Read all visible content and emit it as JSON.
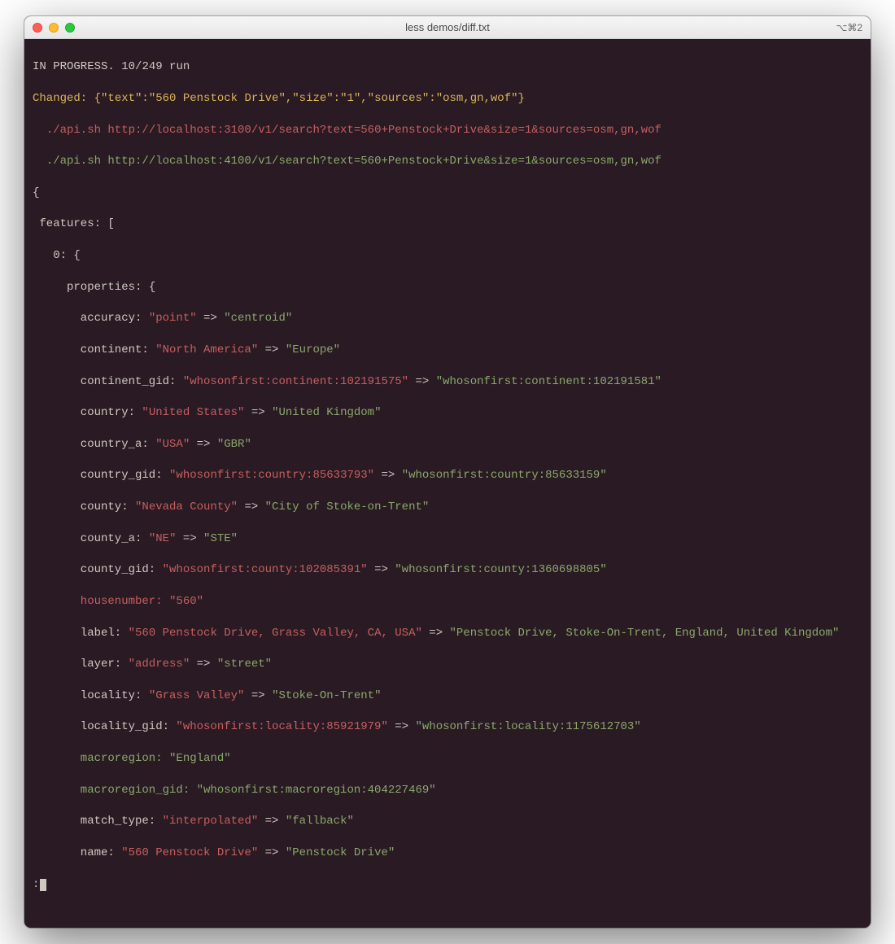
{
  "window": {
    "title": "less demos/diff.txt",
    "right_indicator": "⌥⌘2"
  },
  "progress": {
    "label": "IN PROGRESS.",
    "count": "10/249 run"
  },
  "changed_header": {
    "prefix": "Changed:",
    "json": "{\"text\":\"560 Penstock Drive\",\"size\":\"1\",\"sources\":\"osm,gn,wof\"}"
  },
  "commands": {
    "a": "./api.sh http://localhost:3100/v1/search?text=560+Penstock+Drive&size=1&sources=osm,gn,wof",
    "b": "./api.sh http://localhost:4100/v1/search?text=560+Penstock+Drive&size=1&sources=osm,gn,wof"
  },
  "struct": {
    "open_brace": "{",
    "features": "features: [",
    "idx0": "0: {",
    "properties": "properties: {"
  },
  "diff": {
    "accuracy": {
      "key": "accuracy:",
      "old": "\"point\"",
      "arrow": " => ",
      "new": "\"centroid\""
    },
    "continent": {
      "key": "continent:",
      "old": "\"North America\"",
      "arrow": " => ",
      "new": "\"Europe\""
    },
    "continent_gid": {
      "key": "continent_gid:",
      "old": "\"whosonfirst:continent:102191575\"",
      "arrow": " => ",
      "new": "\"whosonfirst:continent:102191581\""
    },
    "country": {
      "key": "country:",
      "old": "\"United States\"",
      "arrow": " => ",
      "new": "\"United Kingdom\""
    },
    "country_a": {
      "key": "country_a:",
      "old": "\"USA\"",
      "arrow": " => ",
      "new": "\"GBR\""
    },
    "country_gid": {
      "key": "country_gid:",
      "old": "\"whosonfirst:country:85633793\"",
      "arrow": " => ",
      "new": "\"whosonfirst:country:85633159\""
    },
    "county": {
      "key": "county:",
      "old": "\"Nevada County\"",
      "arrow": " => ",
      "new": "\"City of Stoke-on-Trent\""
    },
    "county_a": {
      "key": "county_a:",
      "old": "\"NE\"",
      "arrow": " => ",
      "new": "\"STE\""
    },
    "county_gid": {
      "key": "county_gid:",
      "old": "\"whosonfirst:county:102085391\"",
      "arrow": " => ",
      "new": "\"whosonfirst:county:1360698805\""
    },
    "housenumber": {
      "key": "housenumber:",
      "old": "\"560\""
    },
    "label": {
      "key": "label:",
      "old": "\"560 Penstock Drive, Grass Valley, CA, USA\"",
      "arrow": " => ",
      "new": "\"Penstock Drive, Stoke-On-Trent, England, United Kingdom\""
    },
    "layer": {
      "key": "layer:",
      "old": "\"address\"",
      "arrow": " => ",
      "new": "\"street\""
    },
    "locality": {
      "key": "locality:",
      "old": "\"Grass Valley\"",
      "arrow": " => ",
      "new": "\"Stoke-On-Trent\""
    },
    "locality_gid": {
      "key": "locality_gid:",
      "old": "\"whosonfirst:locality:85921979\"",
      "arrow": " => ",
      "new": "\"whosonfirst:locality:1175612703\""
    },
    "macroregion": {
      "key": "macroregion:",
      "new": "\"England\""
    },
    "macroregion_gid": {
      "key": "macroregion_gid:",
      "new": "\"whosonfirst:macroregion:404227469\""
    },
    "match_type": {
      "key": "match_type:",
      "old": "\"interpolated\"",
      "arrow": " => ",
      "new": "\"fallback\""
    },
    "name": {
      "key": "name:",
      "old": "\"560 Penstock Drive\"",
      "arrow": " => ",
      "new": "\"Penstock Drive\""
    }
  },
  "prompt": ":"
}
